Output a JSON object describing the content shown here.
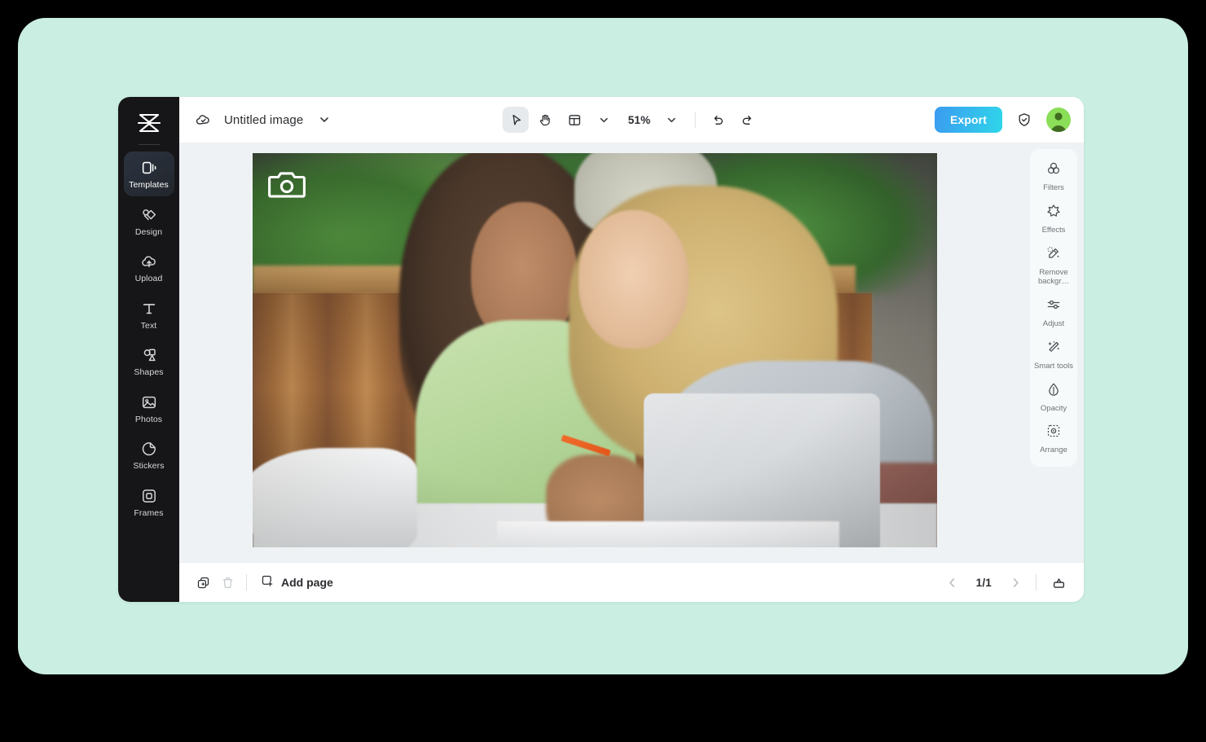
{
  "window": {
    "document_title": "Untitled image",
    "cloud_status_icon": "cloud-check-icon",
    "title_chevron_icon": "chevron-down-icon"
  },
  "left_sidebar": {
    "logo_icon": "capcut-logo-icon",
    "items": [
      {
        "label": "Templates",
        "icon": "templates-icon",
        "active": true
      },
      {
        "label": "Design",
        "icon": "design-icon",
        "active": false
      },
      {
        "label": "Upload",
        "icon": "upload-cloud-icon",
        "active": false
      },
      {
        "label": "Text",
        "icon": "text-icon",
        "active": false
      },
      {
        "label": "Shapes",
        "icon": "shapes-icon",
        "active": false
      },
      {
        "label": "Photos",
        "icon": "photos-icon",
        "active": false
      },
      {
        "label": "Stickers",
        "icon": "stickers-icon",
        "active": false
      },
      {
        "label": "Frames",
        "icon": "frames-icon",
        "active": false
      }
    ]
  },
  "toolbar": {
    "select_tool_icon": "cursor-arrow-icon",
    "hand_tool_icon": "hand-icon",
    "layout_tool_icon": "layout-grid-icon",
    "layout_chevron_icon": "chevron-down-icon",
    "zoom_level": "51%",
    "zoom_chevron_icon": "chevron-down-icon",
    "undo_icon": "undo-arrow-icon",
    "redo_icon": "redo-arrow-icon",
    "export_label": "Export",
    "shield_icon": "shield-check-icon",
    "avatar_icon": "user-avatar-icon"
  },
  "canvas": {
    "camera_badge_icon": "camera-icon",
    "image_description": "Two women smiling at a laptop in a cafe booth"
  },
  "right_panel": {
    "items": [
      {
        "label": "Filters",
        "icon": "filters-circles-icon"
      },
      {
        "label": "Effects",
        "icon": "effects-star-icon"
      },
      {
        "label": "Remove\nbackgr…",
        "icon": "remove-background-icon"
      },
      {
        "label": "Adjust",
        "icon": "adjust-sliders-icon"
      },
      {
        "label": "Smart\ntools",
        "icon": "smart-tools-wand-icon"
      },
      {
        "label": "Opacity",
        "icon": "opacity-drop-icon"
      },
      {
        "label": "Arrange",
        "icon": "arrange-icon"
      }
    ]
  },
  "bottom_bar": {
    "duplicate_icon": "duplicate-page-icon",
    "delete_icon": "trash-icon",
    "add_page_icon": "add-page-icon",
    "add_page_label": "Add page",
    "prev_page_icon": "chevron-left-icon",
    "page_indicator": "1/1",
    "next_page_icon": "chevron-right-icon",
    "grid_view_icon": "page-grid-icon"
  },
  "colors": {
    "stage_background": "#caeee1",
    "outer_background": "#000000",
    "sidebar_background": "#161618",
    "export_gradient_start": "#3b9bf0",
    "export_gradient_end": "#2fd6ea",
    "canvas_background": "#eef2f4",
    "avatar_background": "#8ade58"
  }
}
